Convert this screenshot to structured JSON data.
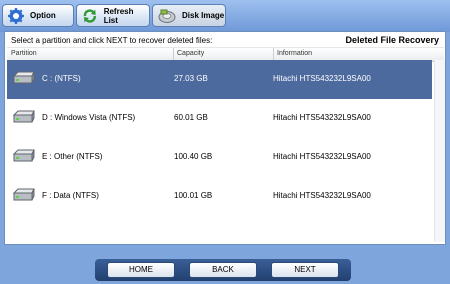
{
  "toolbar": {
    "option_label": "Option",
    "refresh_label": "Refresh List",
    "disk_image_label": "Disk Image"
  },
  "panel": {
    "instruction": "Select a partition and click NEXT to recover deleted files:",
    "title": "Deleted File Recovery"
  },
  "table": {
    "columns": [
      "Partition",
      "Capacity",
      "Information"
    ],
    "rows": [
      {
        "partition": "C :  (NTFS)",
        "capacity": "27.03 GB",
        "info": "Hitachi HTS543232L9SA00",
        "selected": true
      },
      {
        "partition": "D : Windows Vista  (NTFS)",
        "capacity": "60.01 GB",
        "info": "Hitachi HTS543232L9SA00",
        "selected": false
      },
      {
        "partition": "E : Other  (NTFS)",
        "capacity": "100.40 GB",
        "info": "Hitachi HTS543232L9SA00",
        "selected": false
      },
      {
        "partition": "F : Data  (NTFS)",
        "capacity": "100.01 GB",
        "info": "Hitachi HTS543232L9SA00",
        "selected": false
      }
    ]
  },
  "nav": {
    "home_label": "HOME",
    "back_label": "BACK",
    "next_label": "NEXT"
  },
  "colors": {
    "selected_row": "#4d6a9e",
    "background": "#7fa6dc"
  },
  "icons": [
    "gear-icon",
    "refresh-icon",
    "disk-image-icon",
    "hard-drive-icon"
  ]
}
